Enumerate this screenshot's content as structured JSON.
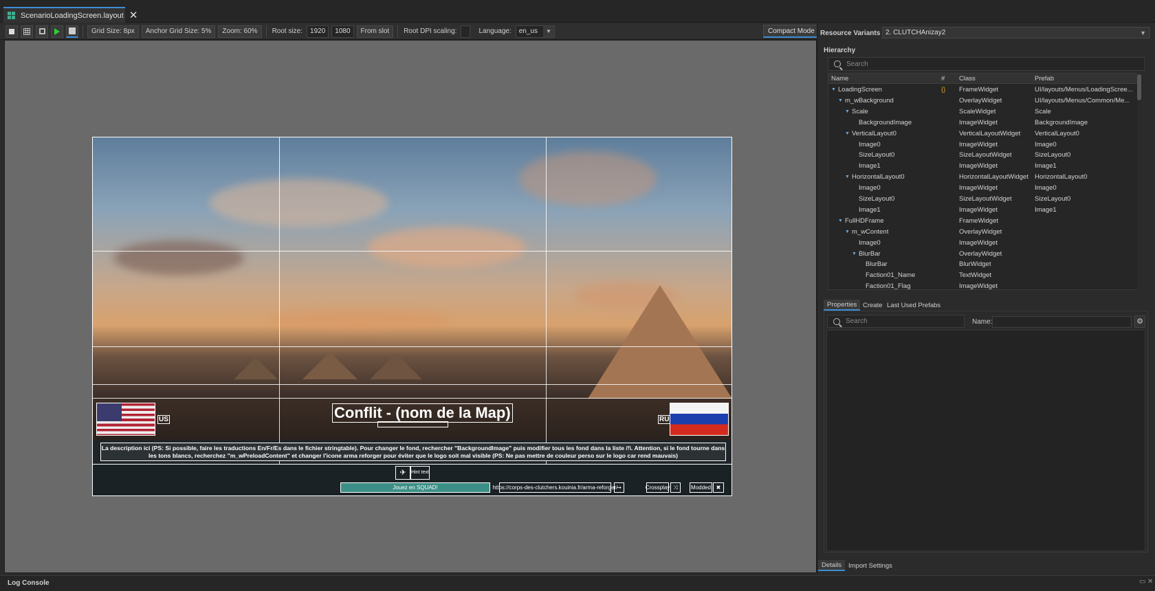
{
  "tab": {
    "title": "ScenarioLoadingScreen.layout"
  },
  "toolbar": {
    "grid_size": "Grid Size: 8px",
    "anchor_grid_size": "Anchor Grid Size: 5%",
    "zoom": "Zoom: 60%",
    "root_size_label": "Root size:",
    "root_w": "1920",
    "root_h": "1080",
    "from_slot": "From slot",
    "root_dpi_label": "Root DPI scaling:",
    "language_label": "Language:",
    "language_value": "en_us",
    "compact_mode": "Compact Mode"
  },
  "preview": {
    "flag_left_code": "US",
    "flag_right_code": "RU",
    "map_title": "Conflit - (nom de la Map)",
    "description": "La description ici (PS: Si possible, faire les traductions En/Fr/Es dans le fichier stringtable). Pour changer le fond, rechercher \"BackgroundImage\" puis modifier tous les fond dans la liste /!\\. Attention, si le fond tourne dans les tons blancs, recherchez \"m_wPreloadContent\" et changer l'icone arma reforger pour éviter que le logo soit mal visible (PS: Ne pas mettre de couleur perso sur le logo car rend mauvais)",
    "hint_text": "Hint text",
    "squad_label": "Jouez en SQUAD!",
    "url": "https://corps-des-clutchers.kouinia.fr/arma-reforger/",
    "crossplay": "Crossplay",
    "modded": "Modded"
  },
  "right_panel": {
    "resource_variants_label": "Resource Variants (2)",
    "resource_variant_value": "2. CLUTCHAnizay2",
    "hierarchy_label": "Hierarchy",
    "search_placeholder": "Search",
    "columns": {
      "name": "Name",
      "hash": "#",
      "class": "Class",
      "prefab": "Prefab"
    },
    "rows": [
      {
        "name": "LoadingScreen",
        "hash": "{}",
        "class": "FrameWidget",
        "prefab": "UI/layouts/Menus/LoadingScree..."
      },
      {
        "name": "m_wBackground",
        "hash": "",
        "class": "OverlayWidget",
        "prefab": "UI/layouts/Menus/Common/Me..."
      },
      {
        "name": "Scale",
        "hash": "",
        "class": "ScaleWidget",
        "prefab": "Scale"
      },
      {
        "name": "BackgroundImage",
        "hash": "",
        "class": "ImageWidget",
        "prefab": "BackgroundImage"
      },
      {
        "name": "VerticalLayout0",
        "hash": "",
        "class": "VerticalLayoutWidget",
        "prefab": "VerticalLayout0"
      },
      {
        "name": "Image0",
        "hash": "",
        "class": "ImageWidget",
        "prefab": "Image0"
      },
      {
        "name": "SizeLayout0",
        "hash": "",
        "class": "SizeLayoutWidget",
        "prefab": "SizeLayout0"
      },
      {
        "name": "Image1",
        "hash": "",
        "class": "ImageWidget",
        "prefab": "Image1"
      },
      {
        "name": "HorizontalLayout0",
        "hash": "",
        "class": "HorizontalLayoutWidget",
        "prefab": "HorizontalLayout0"
      },
      {
        "name": "Image0",
        "hash": "",
        "class": "ImageWidget",
        "prefab": "Image0"
      },
      {
        "name": "SizeLayout0",
        "hash": "",
        "class": "SizeLayoutWidget",
        "prefab": "SizeLayout0"
      },
      {
        "name": "Image1",
        "hash": "",
        "class": "ImageWidget",
        "prefab": "Image1"
      },
      {
        "name": "FullHDFrame",
        "hash": "",
        "class": "FrameWidget",
        "prefab": ""
      },
      {
        "name": "m_wContent",
        "hash": "",
        "class": "OverlayWidget",
        "prefab": ""
      },
      {
        "name": "Image0",
        "hash": "",
        "class": "ImageWidget",
        "prefab": ""
      },
      {
        "name": "BlurBar",
        "hash": "",
        "class": "OverlayWidget",
        "prefab": ""
      },
      {
        "name": "BlurBar",
        "hash": "",
        "class": "BlurWidget",
        "prefab": ""
      },
      {
        "name": "Faction01_Name",
        "hash": "",
        "class": "TextWidget",
        "prefab": ""
      },
      {
        "name": "Faction01_Flag",
        "hash": "",
        "class": "ImageWidget",
        "prefab": ""
      }
    ],
    "props_tabs": [
      "Properties",
      "Create",
      "Last Used Prefabs"
    ],
    "name_label": "Name:",
    "bottom_tabs": [
      "Details",
      "Import Settings"
    ]
  },
  "log_console": {
    "title": "Log Console"
  },
  "colors": {
    "accent": "#3d8fd6",
    "play": "#2fd12f",
    "squad": "#3c8f86"
  }
}
